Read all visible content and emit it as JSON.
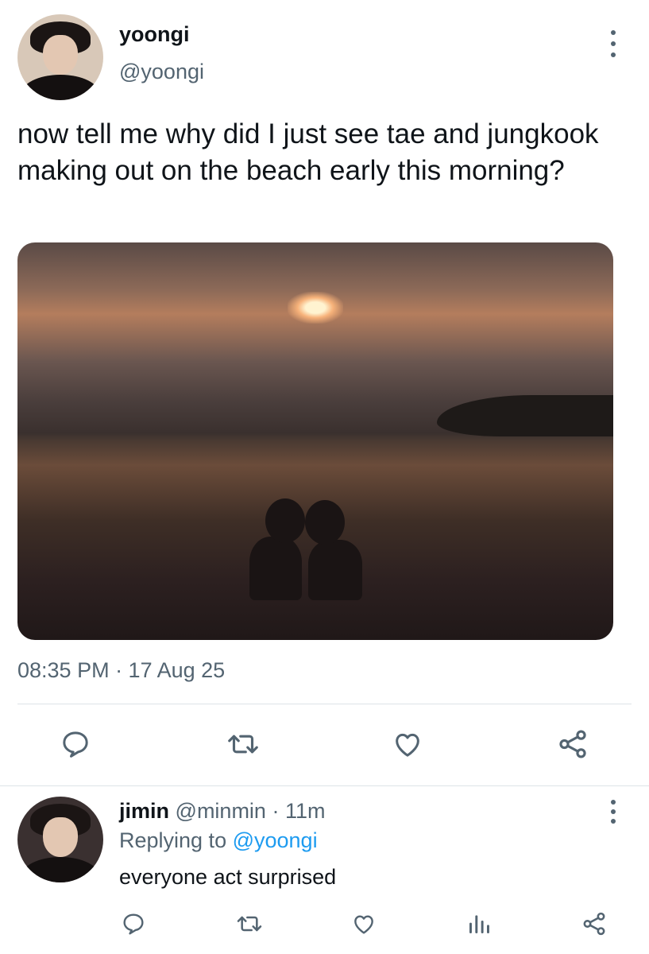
{
  "tweet": {
    "author": {
      "display_name": "yoongi",
      "handle": "@yoongi"
    },
    "text": "now tell me why did I just see tae and jungkook making out on the beach early this morning?",
    "timestamp": "08:35 PM · 17 Aug 25",
    "actions": [
      "reply",
      "retweet",
      "like",
      "share"
    ]
  },
  "reply": {
    "author": {
      "display_name": "jimin",
      "handle": "@minmin"
    },
    "age": "· 11m",
    "replying_prefix": "Replying to ",
    "replying_to": "@yoongi",
    "text": "everyone act surprised",
    "actions": [
      "reply",
      "retweet",
      "like",
      "analytics",
      "share"
    ]
  },
  "colors": {
    "text": "#0f1419",
    "secondary": "#536471",
    "accent": "#1d9bf0",
    "divider": "#dde3e7"
  }
}
